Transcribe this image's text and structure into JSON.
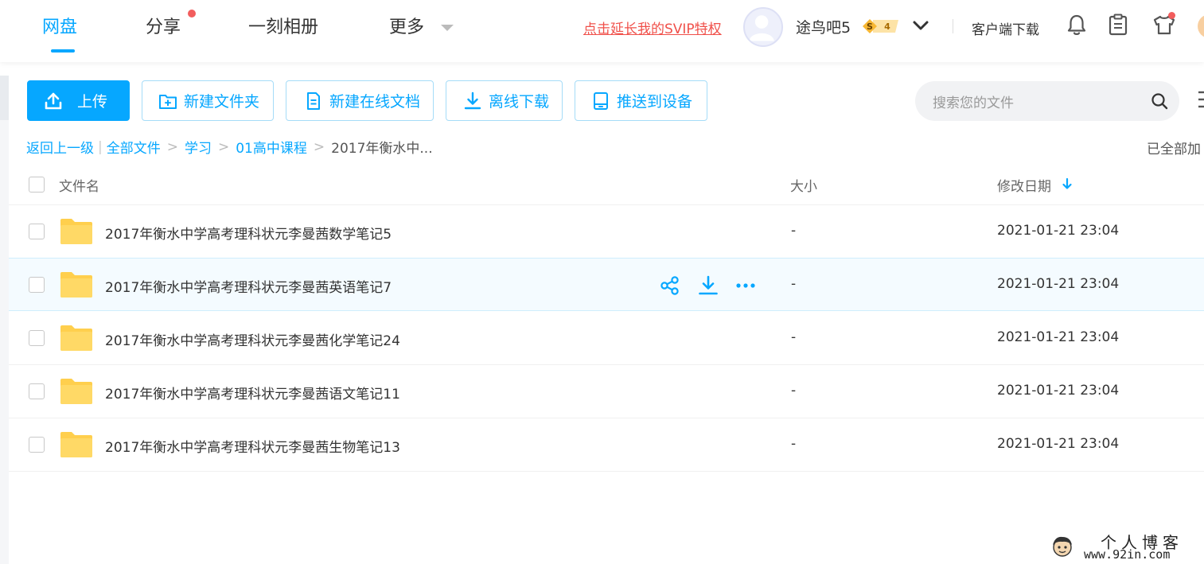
{
  "nav": {
    "items": [
      {
        "label": "网盘",
        "active": true
      },
      {
        "label": "分享",
        "has_dot": true
      },
      {
        "label": "一刻相册"
      },
      {
        "label": "更多"
      }
    ]
  },
  "header": {
    "svip_link": "点击延长我的SVIP特权",
    "username": "途鸟吧5",
    "vip_badge": {
      "letter": "S",
      "level": "4"
    },
    "client_download": "客户端下载",
    "icons": [
      "bell-icon",
      "clipboard-icon",
      "tshirt-icon"
    ]
  },
  "toolbar": {
    "upload": "上传",
    "new_folder": "新建文件夹",
    "new_doc": "新建在线文档",
    "offline_download": "离线下载",
    "push_device": "推送到设备",
    "search_placeholder": "搜索您的文件"
  },
  "breadcrumb": {
    "back": "返回上一级",
    "items": [
      "全部文件",
      "学习",
      "01高中课程"
    ],
    "current": "2017年衡水中...",
    "loaded_status": "已全部加"
  },
  "table": {
    "headers": {
      "name": "文件名",
      "size": "大小",
      "date": "修改日期"
    },
    "sort": "date-desc",
    "rows": [
      {
        "name": "2017年衡水中学高考理科状元李曼茜数学笔记5",
        "size": "-",
        "date": "2021-01-21 23:04"
      },
      {
        "name": "2017年衡水中学高考理科状元李曼茜英语笔记7",
        "size": "-",
        "date": "2021-01-21 23:04",
        "hover": true
      },
      {
        "name": "2017年衡水中学高考理科状元李曼茜化学笔记24",
        "size": "-",
        "date": "2021-01-21 23:04"
      },
      {
        "name": "2017年衡水中学高考理科状元李曼茜语文笔记11",
        "size": "-",
        "date": "2021-01-21 23:04"
      },
      {
        "name": "2017年衡水中学高考理科状元李曼茜生物笔记13",
        "size": "-",
        "date": "2021-01-21 23:04"
      }
    ]
  },
  "watermark": {
    "title": "个人博客",
    "url": "www.92in.com"
  },
  "colors": {
    "accent": "#06a7ff",
    "alert": "#f25d5d",
    "folder": "#ffd15c",
    "svip_link": "#f0504a"
  }
}
